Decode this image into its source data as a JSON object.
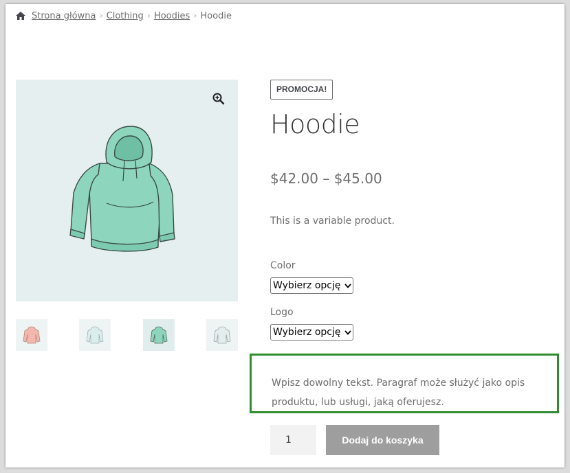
{
  "breadcrumb": {
    "home": "Strona główna",
    "items": [
      "Clothing",
      "Hoodies"
    ],
    "current": "Hoodie",
    "separator": "›"
  },
  "product": {
    "badge": "PROMOCJA!",
    "title": "Hoodie",
    "price": "$42.00 – $45.00",
    "short_description": "This is a variable product.",
    "variations": [
      {
        "label": "Color",
        "selected": "Wybierz opcję"
      },
      {
        "label": "Logo",
        "selected": "Wybierz opcję"
      }
    ],
    "promo_text": "Wpisz dowolny tekst. Paragraf może służyć jako opis produktu, lub usługi, jaką oferujesz.",
    "quantity": "1",
    "add_to_cart_label": "Dodaj do koszyka"
  },
  "gallery": {
    "thumbnails": [
      "pink-hoodie",
      "light-hoodie",
      "green-hoodie",
      "grey-hoodie"
    ]
  },
  "colors": {
    "highlight_border": "#2e8b2e",
    "button_bg": "#9e9e9e",
    "image_bg": "#e6eff0",
    "hoodie_green": "#8dd6bd"
  }
}
